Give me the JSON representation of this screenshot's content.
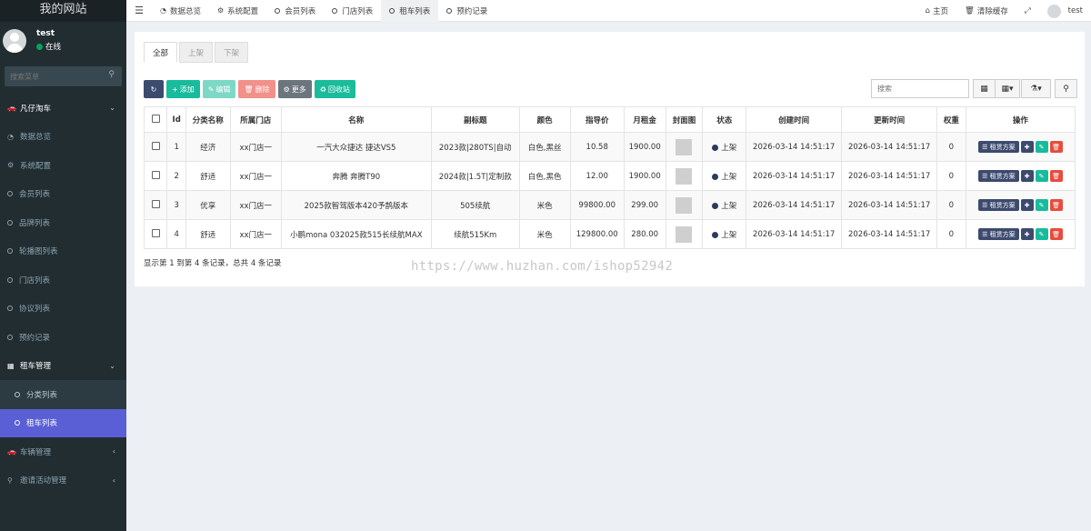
{
  "site_title": "我的网站",
  "user": {
    "name": "test",
    "status": "在线"
  },
  "sidebar": {
    "search_placeholder": "搜索菜单",
    "items": [
      {
        "label": "凡仔淘车",
        "icon": "car-icon",
        "type": "header"
      },
      {
        "label": "数据总览",
        "icon": "dashboard-icon",
        "type": "item"
      },
      {
        "label": "系统配置",
        "icon": "gears-icon",
        "type": "item"
      },
      {
        "label": "会员列表",
        "icon": "circle-icon",
        "type": "item"
      },
      {
        "label": "品牌列表",
        "icon": "circle-icon",
        "type": "item"
      },
      {
        "label": "轮播图列表",
        "icon": "circle-icon",
        "type": "item"
      },
      {
        "label": "门店列表",
        "icon": "circle-icon",
        "type": "item"
      },
      {
        "label": "协议列表",
        "icon": "circle-icon",
        "type": "item"
      },
      {
        "label": "预约记录",
        "icon": "circle-icon",
        "type": "item"
      },
      {
        "label": "租车管理",
        "icon": "folder-icon",
        "type": "header"
      },
      {
        "label": "分类列表",
        "icon": "circle-icon",
        "type": "sub"
      },
      {
        "label": "租车列表",
        "icon": "circle-icon",
        "type": "sub-active"
      },
      {
        "label": "车辆管理",
        "icon": "car-icon",
        "type": "collapsed"
      },
      {
        "label": "邀请活动管理",
        "icon": "search-icon",
        "type": "collapsed"
      }
    ]
  },
  "topbar": {
    "tabs": [
      {
        "label": "数据总览",
        "icon": "dashboard-icon"
      },
      {
        "label": "系统配置",
        "icon": "gears-icon"
      },
      {
        "label": "会员列表",
        "icon": "circle-icon"
      },
      {
        "label": "门店列表",
        "icon": "circle-icon"
      },
      {
        "label": "租车列表",
        "icon": "circle-icon",
        "active": true
      },
      {
        "label": "预约记录",
        "icon": "circle-icon"
      }
    ],
    "right": {
      "home": "主页",
      "clear_cache": "清除缓存",
      "user": "test"
    }
  },
  "status_tabs": [
    "全部",
    "上架",
    "下架"
  ],
  "toolbar": {
    "add": "添加",
    "edit": "编辑",
    "delete": "删除",
    "more": "更多",
    "recycle": "回收站"
  },
  "search": {
    "placeholder": "搜索"
  },
  "table": {
    "headers": [
      "Id",
      "分类名称",
      "所属门店",
      "名称",
      "副标题",
      "颜色",
      "指导价",
      "月租金",
      "封面图",
      "状态",
      "创建时间",
      "更新时间",
      "权重",
      "操作"
    ],
    "rows": [
      {
        "id": "1",
        "category": "经济",
        "store": "xx门店一",
        "name": "一汽大众捷达 捷达VS5",
        "subtitle": "2023款|280TS|自动",
        "color": "白色,黑丝",
        "guide_price": "10.58",
        "monthly_rent": "1900.00",
        "status": "上架",
        "created": "2026-03-14 14:51:17",
        "updated": "2026-03-14 14:51:17",
        "weight": "0"
      },
      {
        "id": "2",
        "category": "舒适",
        "store": "xx门店一",
        "name": "奔腾 奔腾T90",
        "subtitle": "2024款|1.5T|定制款",
        "color": "白色,黑色",
        "guide_price": "12.00",
        "monthly_rent": "1900.00",
        "status": "上架",
        "created": "2026-03-14 14:51:17",
        "updated": "2026-03-14 14:51:17",
        "weight": "0"
      },
      {
        "id": "3",
        "category": "优享",
        "store": "xx门店一",
        "name": "2025款智驾版本420予鹊版本",
        "subtitle": "505续航",
        "color": "米色",
        "guide_price": "99800.00",
        "monthly_rent": "299.00",
        "status": "上架",
        "created": "2026-03-14 14:51:17",
        "updated": "2026-03-14 14:51:17",
        "weight": "0"
      },
      {
        "id": "4",
        "category": "舒适",
        "store": "xx门店一",
        "name": "小鹏mona 032025款515长续航MAX",
        "subtitle": "续航515Km",
        "color": "米色",
        "guide_price": "129800.00",
        "monthly_rent": "280.00",
        "status": "上架",
        "created": "2026-03-14 14:51:17",
        "updated": "2026-03-14 14:51:17",
        "weight": "0"
      }
    ],
    "plan_label": "租赁方案"
  },
  "footer_info": "显示第 1 到第 4 条记录，总共 4 条记录",
  "watermark": "https://www.huzhan.com/ishop52942",
  "colors": {
    "sidebar_bg": "#222d32",
    "active_item": "#5a5fd6",
    "green": "#18bc9c",
    "danger": "#e74c3c",
    "primary_dark": "#3c4a6e"
  }
}
